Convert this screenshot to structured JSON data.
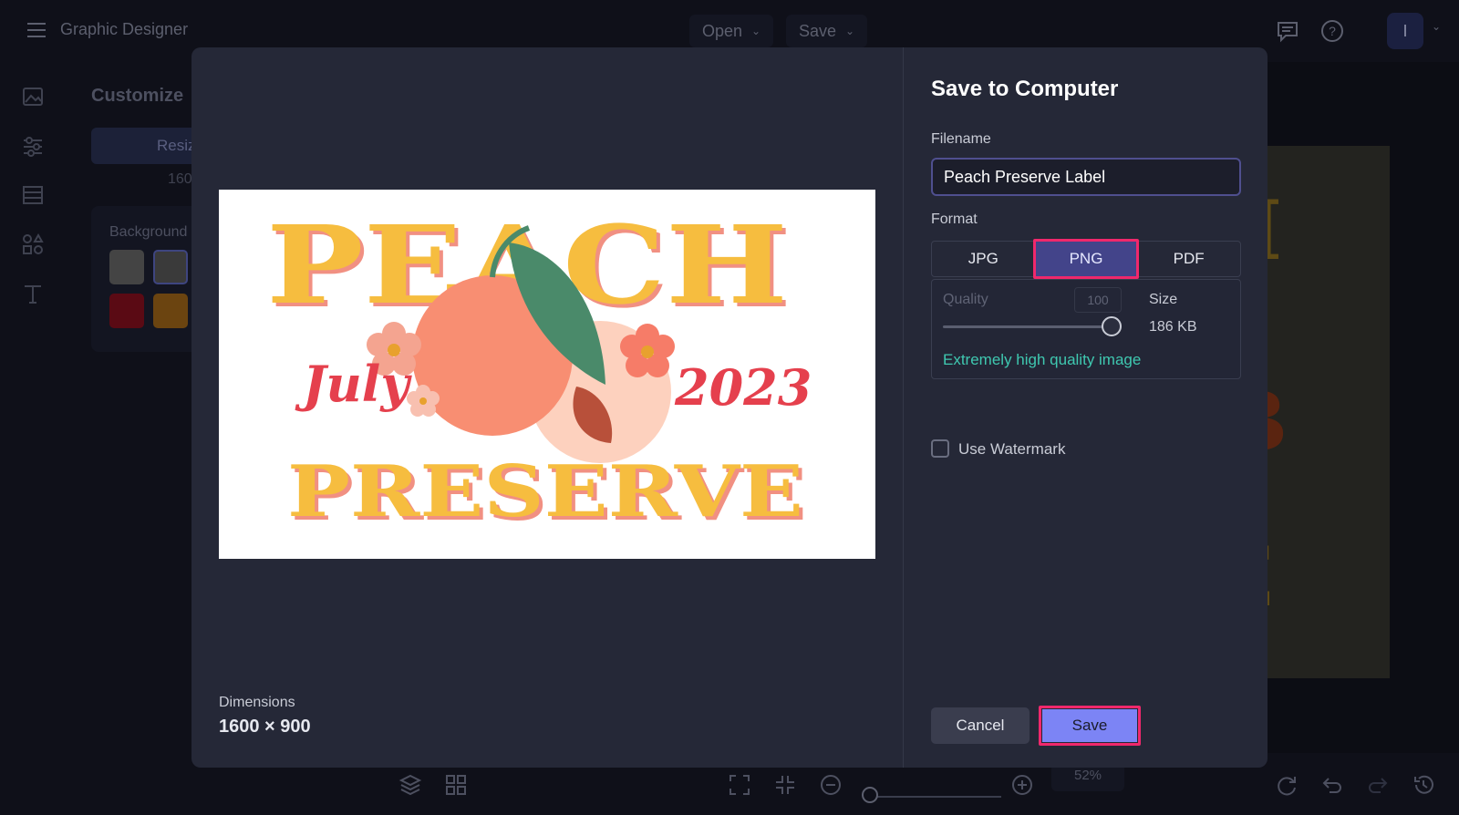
{
  "app": {
    "title": "Graphic Designer",
    "open_label": "Open",
    "save_label": "Save",
    "avatar_initial": "I"
  },
  "sidebar": {
    "panel_title": "Customize",
    "resize_label": "Resize",
    "dimension_text": "160",
    "background_label": "Background",
    "swatch_colors": [
      "#444444",
      "#3a3a3a",
      "#5a0a14",
      "#6b4410"
    ]
  },
  "bottom": {
    "zoom_level": "52%"
  },
  "dialog": {
    "title": "Save to Computer",
    "filename_label": "Filename",
    "filename_value": "Peach Preserve Label",
    "format_label": "Format",
    "formats": [
      "JPG",
      "PNG",
      "PDF"
    ],
    "selected_format": "PNG",
    "quality_label": "Quality",
    "quality_value": "100",
    "quality_fraction": 1.0,
    "size_label": "Size",
    "size_value": "186 KB",
    "quality_description": "Extremely high quality image",
    "watermark_label": "Use Watermark",
    "watermark_checked": false,
    "dimensions_label": "Dimensions",
    "dimensions_value": "1600 × 900",
    "cancel_label": "Cancel",
    "save_label": "Save"
  },
  "design": {
    "line1": "PEACH",
    "line2_left": "July",
    "line2_right": "2023",
    "line3": "PRESERVE",
    "colors": {
      "title_fill": "#f6bd3f",
      "title_shadow": "#f19082",
      "script": "#e5404d",
      "peach": "#f88e72",
      "peach_light": "#fdd1be",
      "leaf": "#4a8a6a",
      "pit": "#b8503a"
    }
  },
  "canvas_preview": {
    "letters": [
      "I",
      "B",
      "E"
    ]
  }
}
